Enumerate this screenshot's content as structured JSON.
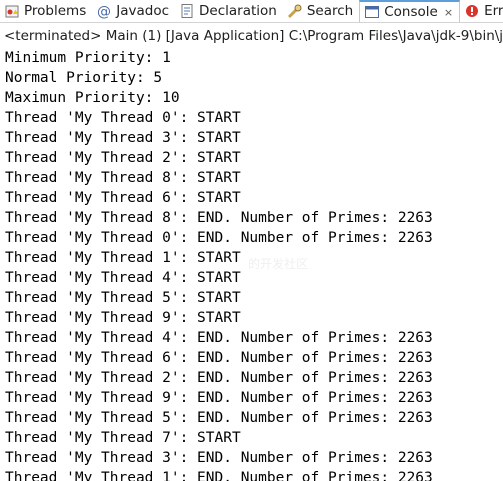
{
  "tabs": [
    {
      "label": "Problems",
      "icon": "problems-icon"
    },
    {
      "label": "Javadoc",
      "icon": "javadoc-icon"
    },
    {
      "label": "Declaration",
      "icon": "declaration-icon"
    },
    {
      "label": "Search",
      "icon": "search-icon"
    },
    {
      "label": "Console",
      "icon": "console-icon",
      "active": true,
      "close": "×"
    },
    {
      "label": "Err",
      "icon": "error-log-icon"
    }
  ],
  "status": "<terminated> Main (1) [Java Application] C:\\Program Files\\Java\\jdk-9\\bin\\j",
  "console_lines": [
    "Minimum Priority: 1",
    "Normal Priority: 5",
    "Maximun Priority: 10",
    "Thread 'My Thread 0': START",
    "Thread 'My Thread 3': START",
    "Thread 'My Thread 2': START",
    "Thread 'My Thread 8': START",
    "Thread 'My Thread 6': START",
    "Thread 'My Thread 8': END. Number of Primes: 2263",
    "Thread 'My Thread 0': END. Number of Primes: 2263",
    "Thread 'My Thread 1': START",
    "Thread 'My Thread 4': START",
    "Thread 'My Thread 5': START",
    "Thread 'My Thread 9': START",
    "Thread 'My Thread 4': END. Number of Primes: 2263",
    "Thread 'My Thread 6': END. Number of Primes: 2263",
    "Thread 'My Thread 2': END. Number of Primes: 2263",
    "Thread 'My Thread 9': END. Number of Primes: 2263",
    "Thread 'My Thread 5': END. Number of Primes: 2263",
    "Thread 'My Thread 7': START",
    "Thread 'My Thread 3': END. Number of Primes: 2263",
    "Thread 'My Thread 1': END. Number of Primes: 2263"
  ],
  "watermark": "的开发社区",
  "colors": {
    "active_tab_accent": "#5c9ddb",
    "text": "#000000",
    "background": "#ffffff"
  }
}
